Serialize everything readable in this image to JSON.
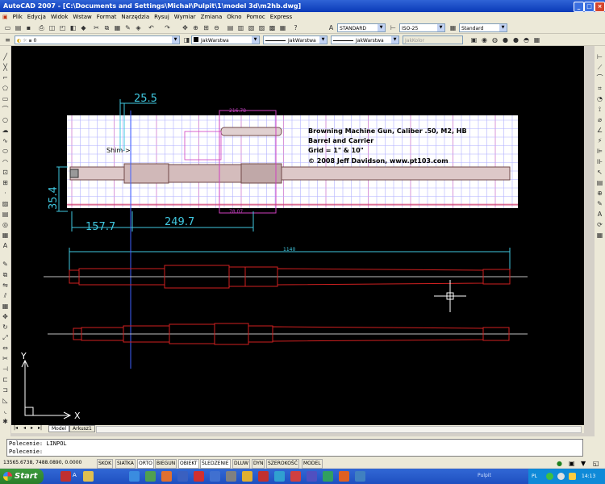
{
  "window": {
    "title": "AutoCAD 2007 - [C:\\Documents and Settings\\Michał\\Pulpit\\1\\model 3d\\m2hb.dwg]",
    "controls": [
      "_",
      "□",
      "×"
    ]
  },
  "menu": {
    "items": [
      "Plik",
      "Edycja",
      "Widok",
      "Wstaw",
      "Format",
      "Narzędzia",
      "Rysuj",
      "Wymiar",
      "Zmiana",
      "Okno",
      "Pomoc",
      "Express"
    ]
  },
  "toolbars": {
    "text_style": "STANDARD",
    "dim_style": "ISO-25",
    "table_style": "Standard",
    "layer": "0",
    "color": "JakWarstwa",
    "linetype": "JakWarstwa",
    "lineweight": "JakWarstwa",
    "plotstyle": "JakKolor"
  },
  "drawing": {
    "reference_title": [
      "Browning Machine Gun, Caliber .50, M2, HB",
      "Barrel and Carrier",
      "Grid = 1\" & 10\"",
      "© 2008 Jeff Davidson, www.pt103.com"
    ],
    "shim_label": "Shim->",
    "dims": {
      "d255": "25.5",
      "d354": "35.4",
      "d1577": "157.7",
      "d2497": "249.7",
      "d21678": "216.78",
      "d7807": "78.07",
      "d1140": "1140"
    },
    "ucs_x": "X",
    "ucs_y": "Y"
  },
  "layout_tabs": [
    "Model",
    "Arkusz1"
  ],
  "command": {
    "line1": "Polecenie: LINPOL",
    "line2": "Polecenie:"
  },
  "status": {
    "coords": "13565.6738, 7488.0890, 0.0000",
    "toggles": [
      "SKOK",
      "SIATKA",
      "ORTO",
      "BIEGUN",
      "OBIEKT",
      "ŚLEDZENIE",
      "DLUW",
      "DYN",
      "SZEROKOŚĆ",
      "MODEL"
    ]
  },
  "taskbar": {
    "start": "Start",
    "item1": "A",
    "tray_text": "Pulpit",
    "lang": "PL",
    "clock": "14:13"
  }
}
